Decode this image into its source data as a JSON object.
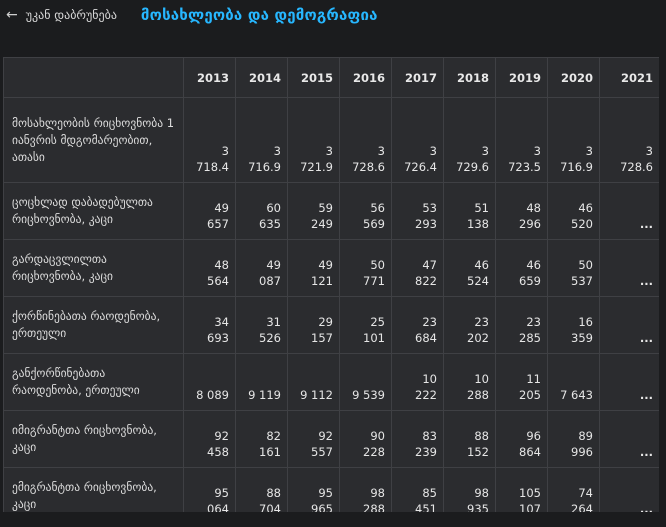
{
  "header": {
    "back_label": "უკან დაბრუნება",
    "title": "მოსახლეობა და დემოგრაფია"
  },
  "table": {
    "years": [
      "2013",
      "2014",
      "2015",
      "2016",
      "2017",
      "2018",
      "2019",
      "2020",
      "2021"
    ],
    "rows": [
      {
        "label": "მოსახლეობის რიცხოვნობა 1 იანვრის მდგომარეობით, ათასი",
        "values": [
          "3\n718.4",
          "3\n716.9",
          "3\n721.9",
          "3\n728.6",
          "3\n726.4",
          "3\n729.6",
          "3\n723.5",
          "3\n716.9",
          "3\n728.6"
        ]
      },
      {
        "label": "ცოცხლად დაბადებულთა რიცხოვნობა, კაცი",
        "values": [
          "49\n657",
          "60\n635",
          "59\n249",
          "56\n569",
          "53\n293",
          "51\n138",
          "48\n296",
          "46\n520",
          "..."
        ]
      },
      {
        "label": "გარდაცვლილთა რიცხოვნობა, კაცი",
        "values": [
          "48\n564",
          "49\n087",
          "49\n121",
          "50\n771",
          "47\n822",
          "46\n524",
          "46\n659",
          "50\n537",
          "..."
        ]
      },
      {
        "label": "ქორწინებათა რაოდენობა, ერთეული",
        "values": [
          "34\n693",
          "31\n526",
          "29\n157",
          "25\n101",
          "23\n684",
          "23\n202",
          "23\n285",
          "16\n359",
          "..."
        ]
      },
      {
        "label": "განქორწინებათა რაოდენობა, ერთეული",
        "values": [
          "8 089",
          "9 119",
          "9 112",
          "9 539",
          "10\n222",
          "10\n288",
          "11\n205",
          "7 643",
          "..."
        ]
      },
      {
        "label": "იმიგრანტთა რიცხოვნობა, კაცი",
        "values": [
          "92\n458",
          "82\n161",
          "92\n557",
          "90\n228",
          "83\n239",
          "88\n152",
          "96\n864",
          "89\n996",
          "..."
        ]
      },
      {
        "label": "ემიგრანტთა რიცხოვნობა, კაცი",
        "values": [
          "95\n064",
          "88\n704",
          "95\n965",
          "98\n288",
          "85\n451",
          "98\n935",
          "105\n107",
          "74\n264",
          "..."
        ]
      }
    ]
  }
}
